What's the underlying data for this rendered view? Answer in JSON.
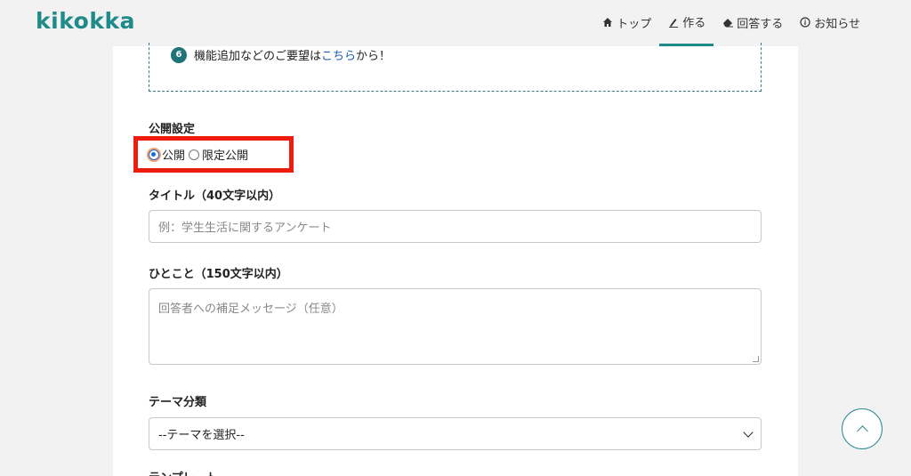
{
  "header": {
    "logo": "kikokka",
    "nav": [
      {
        "label": "トップ",
        "icon": "home-icon"
      },
      {
        "label": "作る",
        "icon": "pen-icon"
      },
      {
        "label": "回答する",
        "icon": "eraser-icon"
      },
      {
        "label": "お知らせ",
        "icon": "info-icon"
      }
    ],
    "active_tab": "作る",
    "accent_color": "#1f8a8a"
  },
  "notice": {
    "step_number": "6",
    "text_before": "機能追加などのご要望は",
    "link_text": "こちら",
    "text_after": "から！"
  },
  "form": {
    "visibility": {
      "label": "公開設定",
      "options": [
        "公開",
        "限定公開"
      ],
      "selected": "公開"
    },
    "title_field": {
      "label": "タイトル（40文字以内）",
      "placeholder": "例：学生生活に関するアンケート"
    },
    "comment_field": {
      "label": "ひとこと（150文字以内）",
      "placeholder": "回答者への補足メッセージ（任意）"
    },
    "theme_field": {
      "label": "テーマ分類",
      "selected": "--テーマを選択--"
    },
    "next_label": "テンプレート"
  },
  "highlight_color": "#ee1c0c"
}
